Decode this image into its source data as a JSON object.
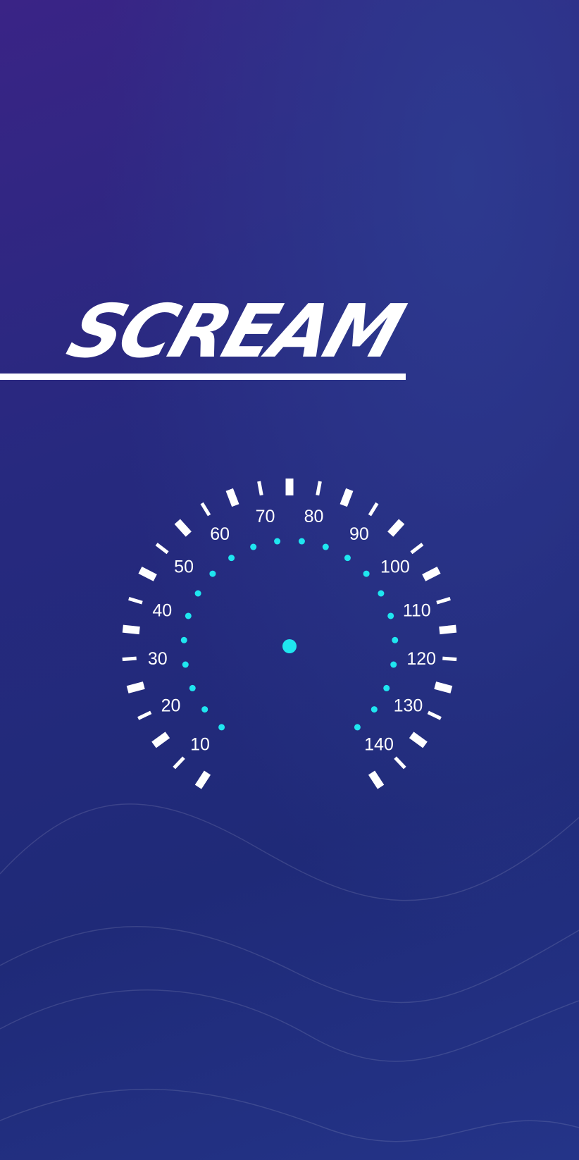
{
  "app": {
    "title": "SCREAM"
  },
  "speedometer": {
    "labels": [
      "10",
      "20",
      "30",
      "40",
      "50",
      "60",
      "70",
      "80",
      "90",
      "100",
      "110",
      "120",
      "130",
      "140"
    ],
    "major_tick_count": 15,
    "minor_tick_count": 14,
    "dot_count": 22
  },
  "colors": {
    "accent": "#1fe6f0",
    "text": "#ffffff",
    "background_top": "#3a2486",
    "background_bottom": "#243488"
  }
}
